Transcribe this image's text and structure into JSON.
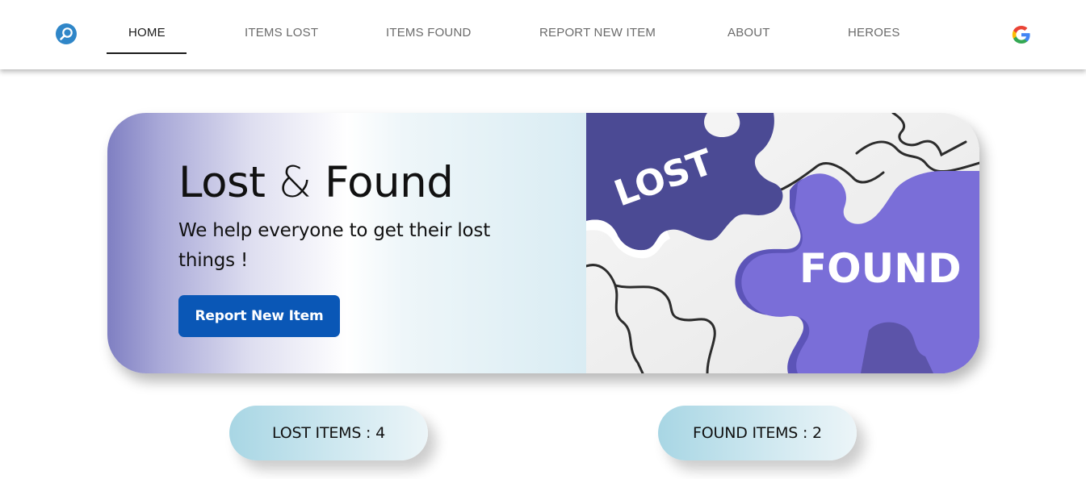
{
  "nav": {
    "logo_icon": "search-magnifier-icon",
    "items": [
      {
        "label": "HOME",
        "active": true
      },
      {
        "label": "ITEMS LOST",
        "active": false
      },
      {
        "label": "ITEMS FOUND",
        "active": false
      },
      {
        "label": "REPORT NEW ITEM",
        "active": false
      },
      {
        "label": "ABOUT",
        "active": false
      },
      {
        "label": "HEROES",
        "active": false
      }
    ],
    "google_icon": "google-g-icon"
  },
  "hero": {
    "title_part1": "Lost",
    "title_amp": "&",
    "title_part2": "Found",
    "subtitle": "We help everyone to get their lost things !",
    "button_label": "Report New Item",
    "image": {
      "piece_left_text": "LOST",
      "piece_right_text": "FOUND"
    }
  },
  "stats": {
    "lost_label": "LOST ITEMS : 4",
    "found_label": "FOUND ITEMS : 2"
  },
  "colors": {
    "accent_blue": "#0a57b6",
    "logo_blue": "#2f86c8",
    "puzzle_dark": "#4b4a94",
    "puzzle_light": "#7a6ed8",
    "pill_blue": "#a8d6e4"
  }
}
